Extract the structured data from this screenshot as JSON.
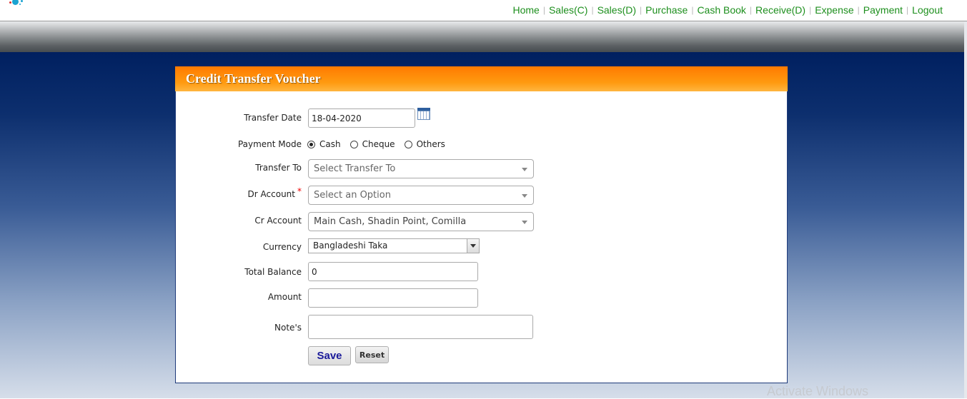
{
  "nav": {
    "items": [
      "Home",
      "Sales(C)",
      "Sales(D)",
      "Purchase",
      "Cash Book",
      "Receive(D)",
      "Expense",
      "Payment",
      "Logout"
    ],
    "link_color": "#1d8f1d"
  },
  "form": {
    "title": "Credit Transfer Voucher",
    "header_color": "#ff8c00",
    "transfer_date": {
      "label": "Transfer Date",
      "value": "18-04-2020"
    },
    "payment_mode": {
      "label": "Payment Mode",
      "options": [
        "Cash",
        "Cheque",
        "Others"
      ],
      "selected": "Cash"
    },
    "transfer_to": {
      "label": "Transfer To",
      "placeholder": "Select Transfer To"
    },
    "dr_account": {
      "label": "Dr Account",
      "required_mark": "*",
      "placeholder": "Select an Option"
    },
    "cr_account": {
      "label": "Cr Account",
      "value": "Main Cash, Shadin Point, Comilla"
    },
    "currency": {
      "label": "Currency",
      "value": "Bangladeshi Taka"
    },
    "total_balance": {
      "label": "Total Balance",
      "value": "0"
    },
    "amount": {
      "label": "Amount",
      "value": ""
    },
    "notes": {
      "label": "Note's",
      "value": ""
    },
    "save_label": "Save",
    "reset_label": "Reset"
  },
  "watermark": "Activate Windows"
}
